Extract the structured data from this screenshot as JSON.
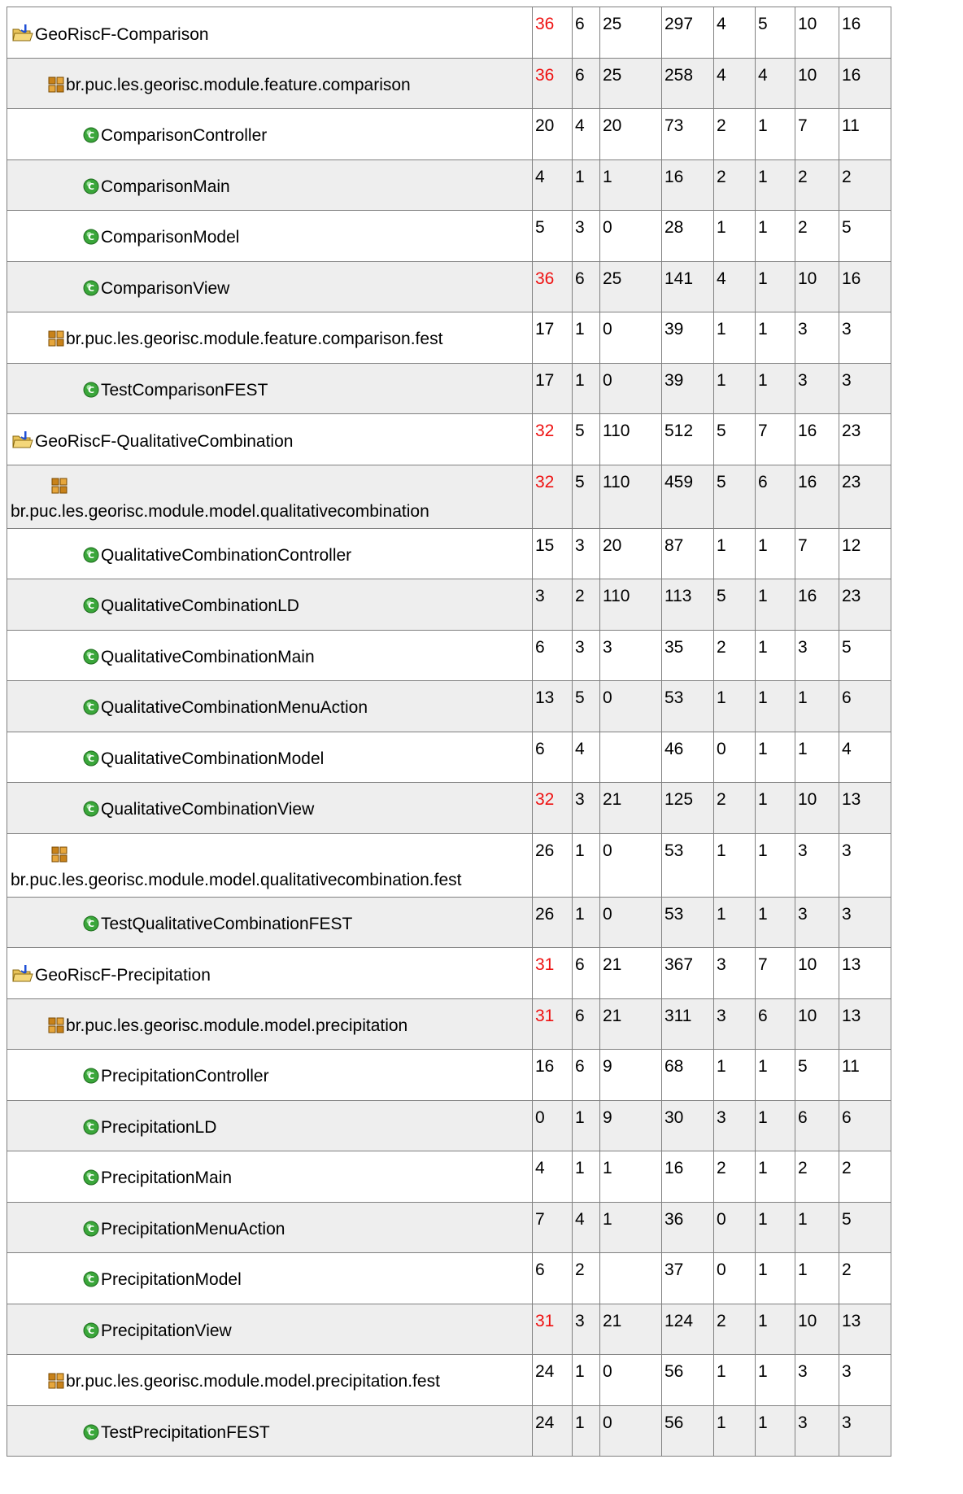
{
  "metrics_table": {
    "rows": [
      {
        "type": "project",
        "name": "GeoRiscF-Comparison",
        "values": [
          "36",
          "6",
          "25",
          "297",
          "4",
          "5",
          "10",
          "16"
        ],
        "red": [
          0
        ],
        "icon": "project-folder-icon"
      },
      {
        "type": "package",
        "name": "br.puc.les.georisc.module.feature.comparison",
        "values": [
          "36",
          "6",
          "25",
          "258",
          "4",
          "4",
          "10",
          "16"
        ],
        "red": [
          0
        ],
        "icon": "package-icon"
      },
      {
        "type": "class",
        "name": "ComparisonController",
        "values": [
          "20",
          "4",
          "20",
          "73",
          "2",
          "1",
          "7",
          "11"
        ],
        "red": [],
        "icon": "class-icon"
      },
      {
        "type": "class",
        "name": "ComparisonMain",
        "values": [
          "4",
          "1",
          "1",
          "16",
          "2",
          "1",
          "2",
          "2"
        ],
        "red": [],
        "icon": "class-icon"
      },
      {
        "type": "class",
        "name": "ComparisonModel",
        "values": [
          "5",
          "3",
          "0",
          "28",
          "1",
          "1",
          "2",
          "5"
        ],
        "red": [],
        "icon": "class-icon"
      },
      {
        "type": "class",
        "name": "ComparisonView",
        "values": [
          "36",
          "6",
          "25",
          "141",
          "4",
          "1",
          "10",
          "16"
        ],
        "red": [
          0
        ],
        "icon": "class-icon"
      },
      {
        "type": "package",
        "name": "br.puc.les.georisc.module.feature.comparison.fest",
        "values": [
          "17",
          "1",
          "0",
          "39",
          "1",
          "1",
          "3",
          "3"
        ],
        "red": [],
        "icon": "package-icon"
      },
      {
        "type": "class",
        "name": "TestComparisonFEST",
        "values": [
          "17",
          "1",
          "0",
          "39",
          "1",
          "1",
          "3",
          "3"
        ],
        "red": [],
        "icon": "class-icon"
      },
      {
        "type": "project",
        "name": "GeoRiscF-QualitativeCombination",
        "values": [
          "32",
          "5",
          "110",
          "512",
          "5",
          "7",
          "16",
          "23"
        ],
        "red": [
          0
        ],
        "icon": "project-folder-icon"
      },
      {
        "type": "package-wrap",
        "name": "br.puc.les.georisc.module.model.qualitativecombination",
        "values": [
          "32",
          "5",
          "110",
          "459",
          "5",
          "6",
          "16",
          "23"
        ],
        "red": [
          0
        ],
        "icon": "package-icon"
      },
      {
        "type": "class",
        "name": "QualitativeCombinationController",
        "values": [
          "15",
          "3",
          "20",
          "87",
          "1",
          "1",
          "7",
          "12"
        ],
        "red": [],
        "icon": "class-icon"
      },
      {
        "type": "class",
        "name": "QualitativeCombinationLD",
        "values": [
          "3",
          "2",
          "110",
          "113",
          "5",
          "1",
          "16",
          "23"
        ],
        "red": [],
        "icon": "class-icon"
      },
      {
        "type": "class",
        "name": "QualitativeCombinationMain",
        "values": [
          "6",
          "3",
          "3",
          "35",
          "2",
          "1",
          "3",
          "5"
        ],
        "red": [],
        "icon": "class-icon"
      },
      {
        "type": "class",
        "name": "QualitativeCombinationMenuAction",
        "values": [
          "13",
          "5",
          "0",
          "53",
          "1",
          "1",
          "1",
          "6"
        ],
        "red": [],
        "icon": "class-icon"
      },
      {
        "type": "class",
        "name": "QualitativeCombinationModel",
        "values": [
          "6",
          "4",
          "",
          "46",
          "0",
          "1",
          "1",
          "4"
        ],
        "red": [],
        "icon": "class-icon"
      },
      {
        "type": "class",
        "name": "QualitativeCombinationView",
        "values": [
          "32",
          "3",
          "21",
          "125",
          "2",
          "1",
          "10",
          "13"
        ],
        "red": [
          0
        ],
        "icon": "class-icon"
      },
      {
        "type": "package-wrap",
        "name": "br.puc.les.georisc.module.model.qualitativecombination.fest",
        "values": [
          "26",
          "1",
          "0",
          "53",
          "1",
          "1",
          "3",
          "3"
        ],
        "red": [],
        "icon": "package-icon"
      },
      {
        "type": "class",
        "name": "TestQualitativeCombinationFEST",
        "values": [
          "26",
          "1",
          "0",
          "53",
          "1",
          "1",
          "3",
          "3"
        ],
        "red": [],
        "icon": "class-icon"
      },
      {
        "type": "project",
        "name": "GeoRiscF-Precipitation",
        "values": [
          "31",
          "6",
          "21",
          "367",
          "3",
          "7",
          "10",
          "13"
        ],
        "red": [
          0
        ],
        "icon": "project-folder-icon"
      },
      {
        "type": "package",
        "name": "br.puc.les.georisc.module.model.precipitation",
        "values": [
          "31",
          "6",
          "21",
          "311",
          "3",
          "6",
          "10",
          "13"
        ],
        "red": [
          0
        ],
        "icon": "package-icon"
      },
      {
        "type": "class",
        "name": "PrecipitationController",
        "values": [
          "16",
          "6",
          "9",
          "68",
          "1",
          "1",
          "5",
          "11"
        ],
        "red": [],
        "icon": "class-icon"
      },
      {
        "type": "class",
        "name": "PrecipitationLD",
        "values": [
          "0",
          "1",
          "9",
          "30",
          "3",
          "1",
          "6",
          "6"
        ],
        "red": [],
        "icon": "class-icon"
      },
      {
        "type": "class",
        "name": "PrecipitationMain",
        "values": [
          "4",
          "1",
          "1",
          "16",
          "2",
          "1",
          "2",
          "2"
        ],
        "red": [],
        "icon": "class-icon"
      },
      {
        "type": "class",
        "name": "PrecipitationMenuAction",
        "values": [
          "7",
          "4",
          "1",
          "36",
          "0",
          "1",
          "1",
          "5"
        ],
        "red": [],
        "icon": "class-icon"
      },
      {
        "type": "class",
        "name": "PrecipitationModel",
        "values": [
          "6",
          "2",
          "",
          "37",
          "0",
          "1",
          "1",
          "2"
        ],
        "red": [],
        "icon": "class-icon"
      },
      {
        "type": "class",
        "name": "PrecipitationView",
        "values": [
          "31",
          "3",
          "21",
          "124",
          "2",
          "1",
          "10",
          "13"
        ],
        "red": [
          0
        ],
        "icon": "class-icon"
      },
      {
        "type": "package",
        "name": "br.puc.les.georisc.module.model.precipitation.fest",
        "values": [
          "24",
          "1",
          "0",
          "56",
          "1",
          "1",
          "3",
          "3"
        ],
        "red": [],
        "icon": "package-icon"
      },
      {
        "type": "class",
        "name": "TestPrecipitationFEST",
        "values": [
          "24",
          "1",
          "0",
          "56",
          "1",
          "1",
          "3",
          "3"
        ],
        "red": [],
        "icon": "class-icon"
      }
    ]
  },
  "colors": {
    "highlight": "#ee1111",
    "shade": "#eeeeee",
    "border": "#808080"
  }
}
